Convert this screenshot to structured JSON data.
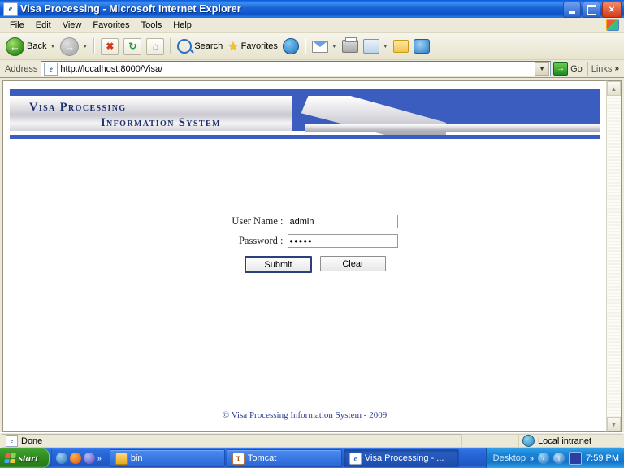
{
  "window": {
    "title": "Visa Processing - Microsoft Internet Explorer",
    "title_icon": "ie-document-icon",
    "minimize_label": "_",
    "maximize_label": "❐",
    "close_label": "✕"
  },
  "menu": {
    "items": [
      {
        "label": "File"
      },
      {
        "label": "Edit"
      },
      {
        "label": "View"
      },
      {
        "label": "Favorites"
      },
      {
        "label": "Tools"
      },
      {
        "label": "Help"
      }
    ]
  },
  "toolbar": {
    "back_label": "Back",
    "back_caret": "▼",
    "forward_caret": "▼",
    "back_arrow": "←",
    "forward_arrow": "→",
    "stop_glyph": "✖",
    "refresh_glyph": "↻",
    "home_glyph": "⌂",
    "search_label": "Search",
    "favorites_label": "Favorites",
    "media_glyph": "▶",
    "mail_caret": "▼",
    "edit_caret": "▼"
  },
  "address": {
    "label": "Address",
    "url": "http://localhost:8000/Visa/",
    "dropdown_caret": "▼",
    "go_label": "Go",
    "go_glyph": "→",
    "links_label": "Links",
    "links_chevron": "»"
  },
  "banner": {
    "line1": "Visa Processing",
    "line2": "Information System",
    "blue": "#3b5dc0",
    "text_color": "#1d2f6e"
  },
  "form": {
    "username_label": "User Name :",
    "username_value": "admin",
    "username_placeholder": "",
    "password_label": "Password :",
    "password_value": "•••••",
    "password_placeholder": "",
    "submit_label": "Submit",
    "clear_label": "Clear"
  },
  "footer": {
    "copyright": "© Visa Processing Information System - 2009"
  },
  "statusbar": {
    "status": "Done",
    "zone": "Local intranet"
  },
  "scrollbar": {
    "up_glyph": "▲",
    "down_glyph": "▼"
  },
  "taskbar": {
    "start_label": "start",
    "quicklaunch_chevron": "»",
    "tasks": [
      {
        "label": "bin",
        "icon": "folder-icon",
        "icon_glyph": "",
        "active": false
      },
      {
        "label": "Tomcat",
        "icon": "tomcat-icon",
        "icon_glyph": "T",
        "active": false
      },
      {
        "label": "Visa Processing - ...",
        "icon": "ie-icon",
        "icon_glyph": "e",
        "active": true
      }
    ],
    "tray": {
      "desktop_label": "Desktop",
      "chevron": "»",
      "clock": "7:59 PM"
    }
  }
}
